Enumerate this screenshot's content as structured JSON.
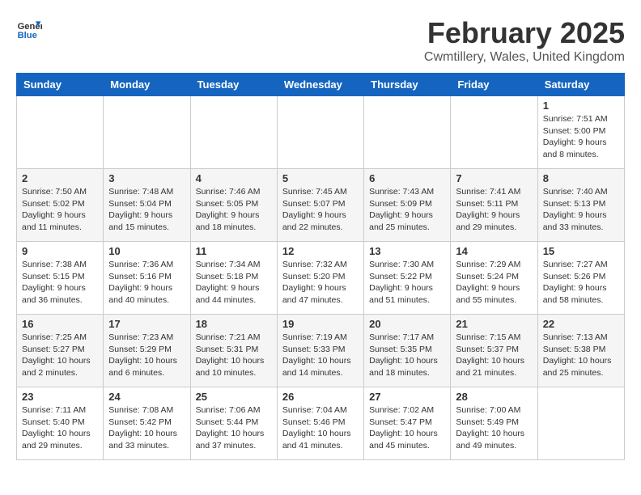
{
  "header": {
    "logo_text_general": "General",
    "logo_text_blue": "Blue",
    "title": "February 2025",
    "subtitle": "Cwmtillery, Wales, United Kingdom"
  },
  "weekdays": [
    "Sunday",
    "Monday",
    "Tuesday",
    "Wednesday",
    "Thursday",
    "Friday",
    "Saturday"
  ],
  "weeks": [
    [
      {
        "day": "",
        "info": ""
      },
      {
        "day": "",
        "info": ""
      },
      {
        "day": "",
        "info": ""
      },
      {
        "day": "",
        "info": ""
      },
      {
        "day": "",
        "info": ""
      },
      {
        "day": "",
        "info": ""
      },
      {
        "day": "1",
        "info": "Sunrise: 7:51 AM\nSunset: 5:00 PM\nDaylight: 9 hours and 8 minutes."
      }
    ],
    [
      {
        "day": "2",
        "info": "Sunrise: 7:50 AM\nSunset: 5:02 PM\nDaylight: 9 hours and 11 minutes."
      },
      {
        "day": "3",
        "info": "Sunrise: 7:48 AM\nSunset: 5:04 PM\nDaylight: 9 hours and 15 minutes."
      },
      {
        "day": "4",
        "info": "Sunrise: 7:46 AM\nSunset: 5:05 PM\nDaylight: 9 hours and 18 minutes."
      },
      {
        "day": "5",
        "info": "Sunrise: 7:45 AM\nSunset: 5:07 PM\nDaylight: 9 hours and 22 minutes."
      },
      {
        "day": "6",
        "info": "Sunrise: 7:43 AM\nSunset: 5:09 PM\nDaylight: 9 hours and 25 minutes."
      },
      {
        "day": "7",
        "info": "Sunrise: 7:41 AM\nSunset: 5:11 PM\nDaylight: 9 hours and 29 minutes."
      },
      {
        "day": "8",
        "info": "Sunrise: 7:40 AM\nSunset: 5:13 PM\nDaylight: 9 hours and 33 minutes."
      }
    ],
    [
      {
        "day": "9",
        "info": "Sunrise: 7:38 AM\nSunset: 5:15 PM\nDaylight: 9 hours and 36 minutes."
      },
      {
        "day": "10",
        "info": "Sunrise: 7:36 AM\nSunset: 5:16 PM\nDaylight: 9 hours and 40 minutes."
      },
      {
        "day": "11",
        "info": "Sunrise: 7:34 AM\nSunset: 5:18 PM\nDaylight: 9 hours and 44 minutes."
      },
      {
        "day": "12",
        "info": "Sunrise: 7:32 AM\nSunset: 5:20 PM\nDaylight: 9 hours and 47 minutes."
      },
      {
        "day": "13",
        "info": "Sunrise: 7:30 AM\nSunset: 5:22 PM\nDaylight: 9 hours and 51 minutes."
      },
      {
        "day": "14",
        "info": "Sunrise: 7:29 AM\nSunset: 5:24 PM\nDaylight: 9 hours and 55 minutes."
      },
      {
        "day": "15",
        "info": "Sunrise: 7:27 AM\nSunset: 5:26 PM\nDaylight: 9 hours and 58 minutes."
      }
    ],
    [
      {
        "day": "16",
        "info": "Sunrise: 7:25 AM\nSunset: 5:27 PM\nDaylight: 10 hours and 2 minutes."
      },
      {
        "day": "17",
        "info": "Sunrise: 7:23 AM\nSunset: 5:29 PM\nDaylight: 10 hours and 6 minutes."
      },
      {
        "day": "18",
        "info": "Sunrise: 7:21 AM\nSunset: 5:31 PM\nDaylight: 10 hours and 10 minutes."
      },
      {
        "day": "19",
        "info": "Sunrise: 7:19 AM\nSunset: 5:33 PM\nDaylight: 10 hours and 14 minutes."
      },
      {
        "day": "20",
        "info": "Sunrise: 7:17 AM\nSunset: 5:35 PM\nDaylight: 10 hours and 18 minutes."
      },
      {
        "day": "21",
        "info": "Sunrise: 7:15 AM\nSunset: 5:37 PM\nDaylight: 10 hours and 21 minutes."
      },
      {
        "day": "22",
        "info": "Sunrise: 7:13 AM\nSunset: 5:38 PM\nDaylight: 10 hours and 25 minutes."
      }
    ],
    [
      {
        "day": "23",
        "info": "Sunrise: 7:11 AM\nSunset: 5:40 PM\nDaylight: 10 hours and 29 minutes."
      },
      {
        "day": "24",
        "info": "Sunrise: 7:08 AM\nSunset: 5:42 PM\nDaylight: 10 hours and 33 minutes."
      },
      {
        "day": "25",
        "info": "Sunrise: 7:06 AM\nSunset: 5:44 PM\nDaylight: 10 hours and 37 minutes."
      },
      {
        "day": "26",
        "info": "Sunrise: 7:04 AM\nSunset: 5:46 PM\nDaylight: 10 hours and 41 minutes."
      },
      {
        "day": "27",
        "info": "Sunrise: 7:02 AM\nSunset: 5:47 PM\nDaylight: 10 hours and 45 minutes."
      },
      {
        "day": "28",
        "info": "Sunrise: 7:00 AM\nSunset: 5:49 PM\nDaylight: 10 hours and 49 minutes."
      },
      {
        "day": "",
        "info": ""
      }
    ]
  ]
}
